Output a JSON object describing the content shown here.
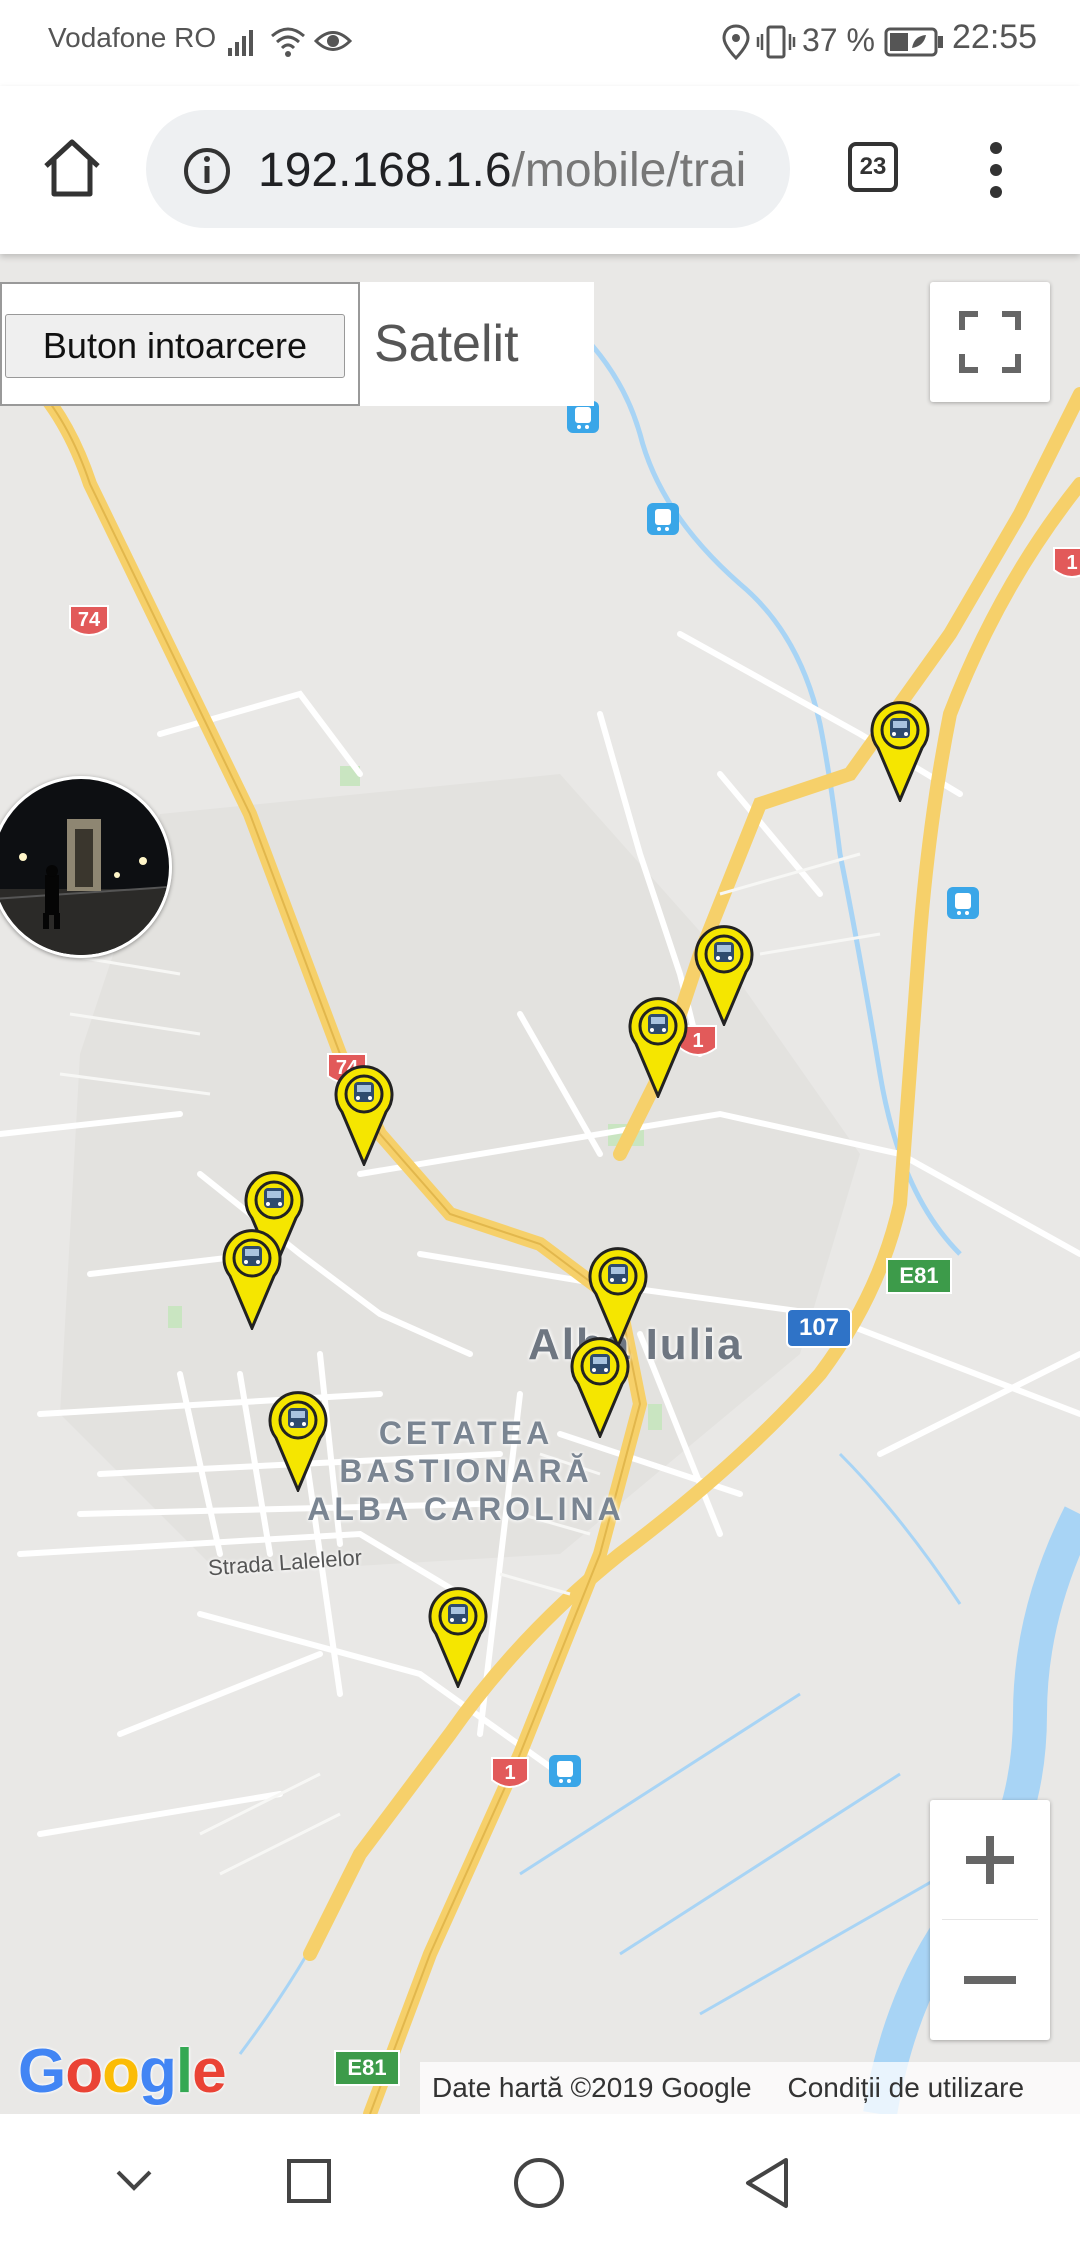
{
  "status_bar": {
    "carrier": "Vodafone RO",
    "battery_percent": "37 %",
    "time": "22:55"
  },
  "browser": {
    "url_host": "192.168.1.6",
    "url_path": "/mobile/trai",
    "tab_count": "23"
  },
  "map": {
    "back_button_label": "Buton intoarcere",
    "map_type_label": "Satelit",
    "city_label": "Alba Iulia",
    "landmark_label_lines": [
      "CETATEA",
      "BASTIONARĂ",
      "ALBA CAROLINA"
    ],
    "street_label": "Strada Lalelelor",
    "road_shields": [
      "74",
      "74",
      "1",
      "1",
      "1",
      "107",
      "E81",
      "E81"
    ],
    "google_logo": "Google",
    "attribution_data": "Date hartă ©2019 Google",
    "attribution_terms": "Condiții de utilizare",
    "marker_icon": "bus-stop-marker-icon",
    "marker_count": 10
  },
  "colors": {
    "marker_fill": "#f5e600",
    "highway": "#f6d06a",
    "water": "#a8d4f5",
    "route_shield": "#e25a5a",
    "e_road_shield": "#3d9b4a",
    "national_shield": "#2f73c7"
  }
}
